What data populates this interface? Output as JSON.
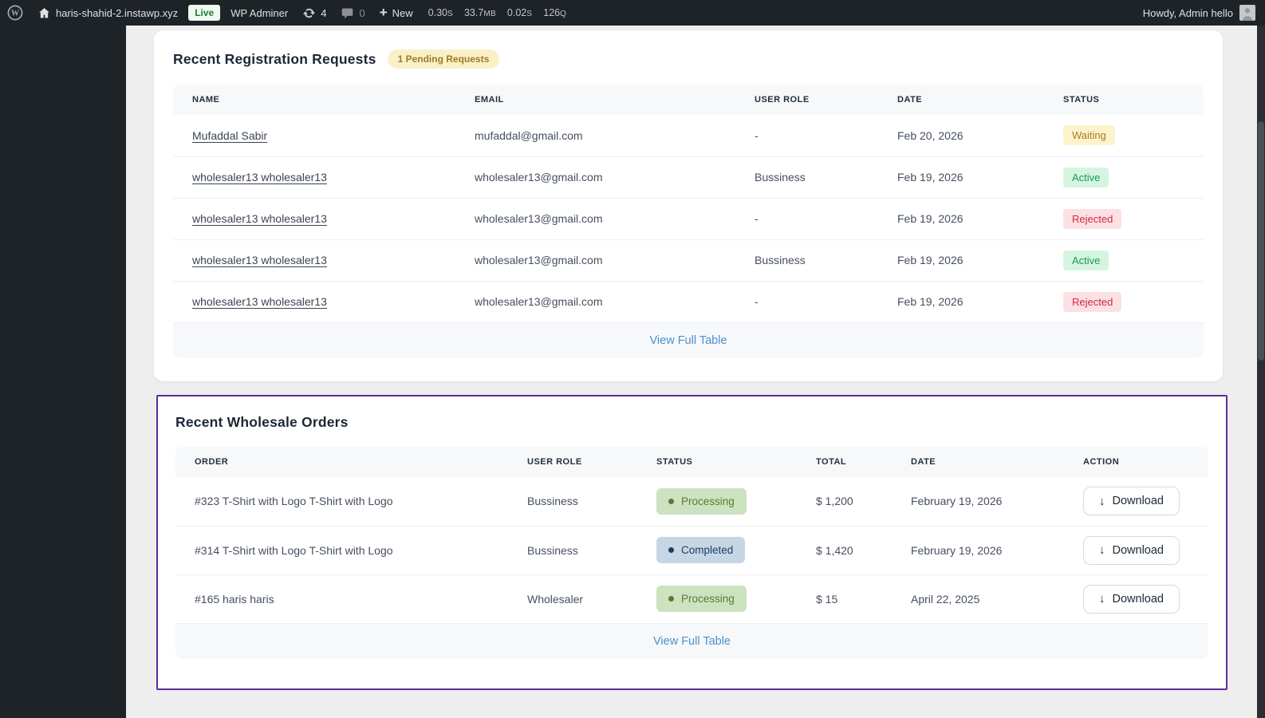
{
  "admin_bar": {
    "site_name": "haris-shahid-2.instawp.xyz",
    "live_badge": "Live",
    "wp_adminer": "WP Adminer",
    "update_count": "4",
    "comment_count": "0",
    "new_label": "New",
    "stats": [
      {
        "value": "0.30",
        "unit": "s"
      },
      {
        "value": "33.7",
        "unit": "MB"
      },
      {
        "value": "0.02",
        "unit": "s"
      },
      {
        "value": "126",
        "unit": "Q"
      }
    ],
    "howdy": "Howdy, Admin hello"
  },
  "icons": {
    "plus": "+",
    "download_arrow": "↓"
  },
  "registration_card": {
    "title": "Recent Registration Requests",
    "pending_badge": "1 Pending Requests",
    "columns": [
      "NAME",
      "EMAIL",
      "USER ROLE",
      "DATE",
      "STATUS"
    ],
    "rows": [
      {
        "name": "Mufaddal Sabir",
        "email": "mufaddal@gmail.com",
        "user_role": "-",
        "date": "Feb 20, 2026",
        "status": "Waiting"
      },
      {
        "name": "wholesaler13 wholesaler13",
        "email": "wholesaler13@gmail.com",
        "user_role": "Bussiness",
        "date": "Feb 19, 2026",
        "status": "Active"
      },
      {
        "name": "wholesaler13 wholesaler13",
        "email": "wholesaler13@gmail.com",
        "user_role": "-",
        "date": "Feb 19, 2026",
        "status": "Rejected"
      },
      {
        "name": "wholesaler13 wholesaler13",
        "email": "wholesaler13@gmail.com",
        "user_role": "Bussiness",
        "date": "Feb 19, 2026",
        "status": "Active"
      },
      {
        "name": "wholesaler13 wholesaler13",
        "email": "wholesaler13@gmail.com",
        "user_role": "-",
        "date": "Feb 19, 2026",
        "status": "Rejected"
      }
    ],
    "view_full_table": "View Full Table"
  },
  "orders_card": {
    "title": "Recent Wholesale Orders",
    "columns": [
      "ORDER",
      "USER ROLE",
      "STATUS",
      "TOTAL",
      "DATE",
      "ACTION"
    ],
    "rows": [
      {
        "order": "#323 T-Shirt with Logo T-Shirt with Logo",
        "user_role": "Bussiness",
        "status": "Processing",
        "total": "$ 1,200",
        "date": "February 19, 2026",
        "action": "Download"
      },
      {
        "order": "#314 T-Shirt with Logo T-Shirt with Logo",
        "user_role": "Bussiness",
        "status": "Completed",
        "total": "$ 1,420",
        "date": "February 19, 2026",
        "action": "Download"
      },
      {
        "order": "#165 haris haris",
        "user_role": "Wholesaler",
        "status": "Processing",
        "total": "$ 15",
        "date": "April 22, 2025",
        "action": "Download"
      }
    ],
    "view_full_table": "View Full Table"
  },
  "colors": {
    "admin_bar_bg": "#1d2327",
    "accent_purple": "#5e2b97",
    "link_blue": "#4a90d2",
    "live_badge_bg": "#eef9ef",
    "live_badge_text": "#1e7e34",
    "pending_badge_bg": "#faf0c8",
    "pending_badge_text": "#9c7c1e",
    "badge_waiting_bg": "#fcf3cc",
    "badge_waiting_text": "#a3801b",
    "badge_active_bg": "#d6f5e0",
    "badge_active_text": "#169a56",
    "badge_rejected_bg": "#fce1e4",
    "badge_rejected_text": "#d02943",
    "badge_processing_bg": "#cde2c0",
    "badge_processing_text": "#567c2e",
    "badge_completed_bg": "#c7d6e5",
    "badge_completed_text": "#1b3d63"
  }
}
